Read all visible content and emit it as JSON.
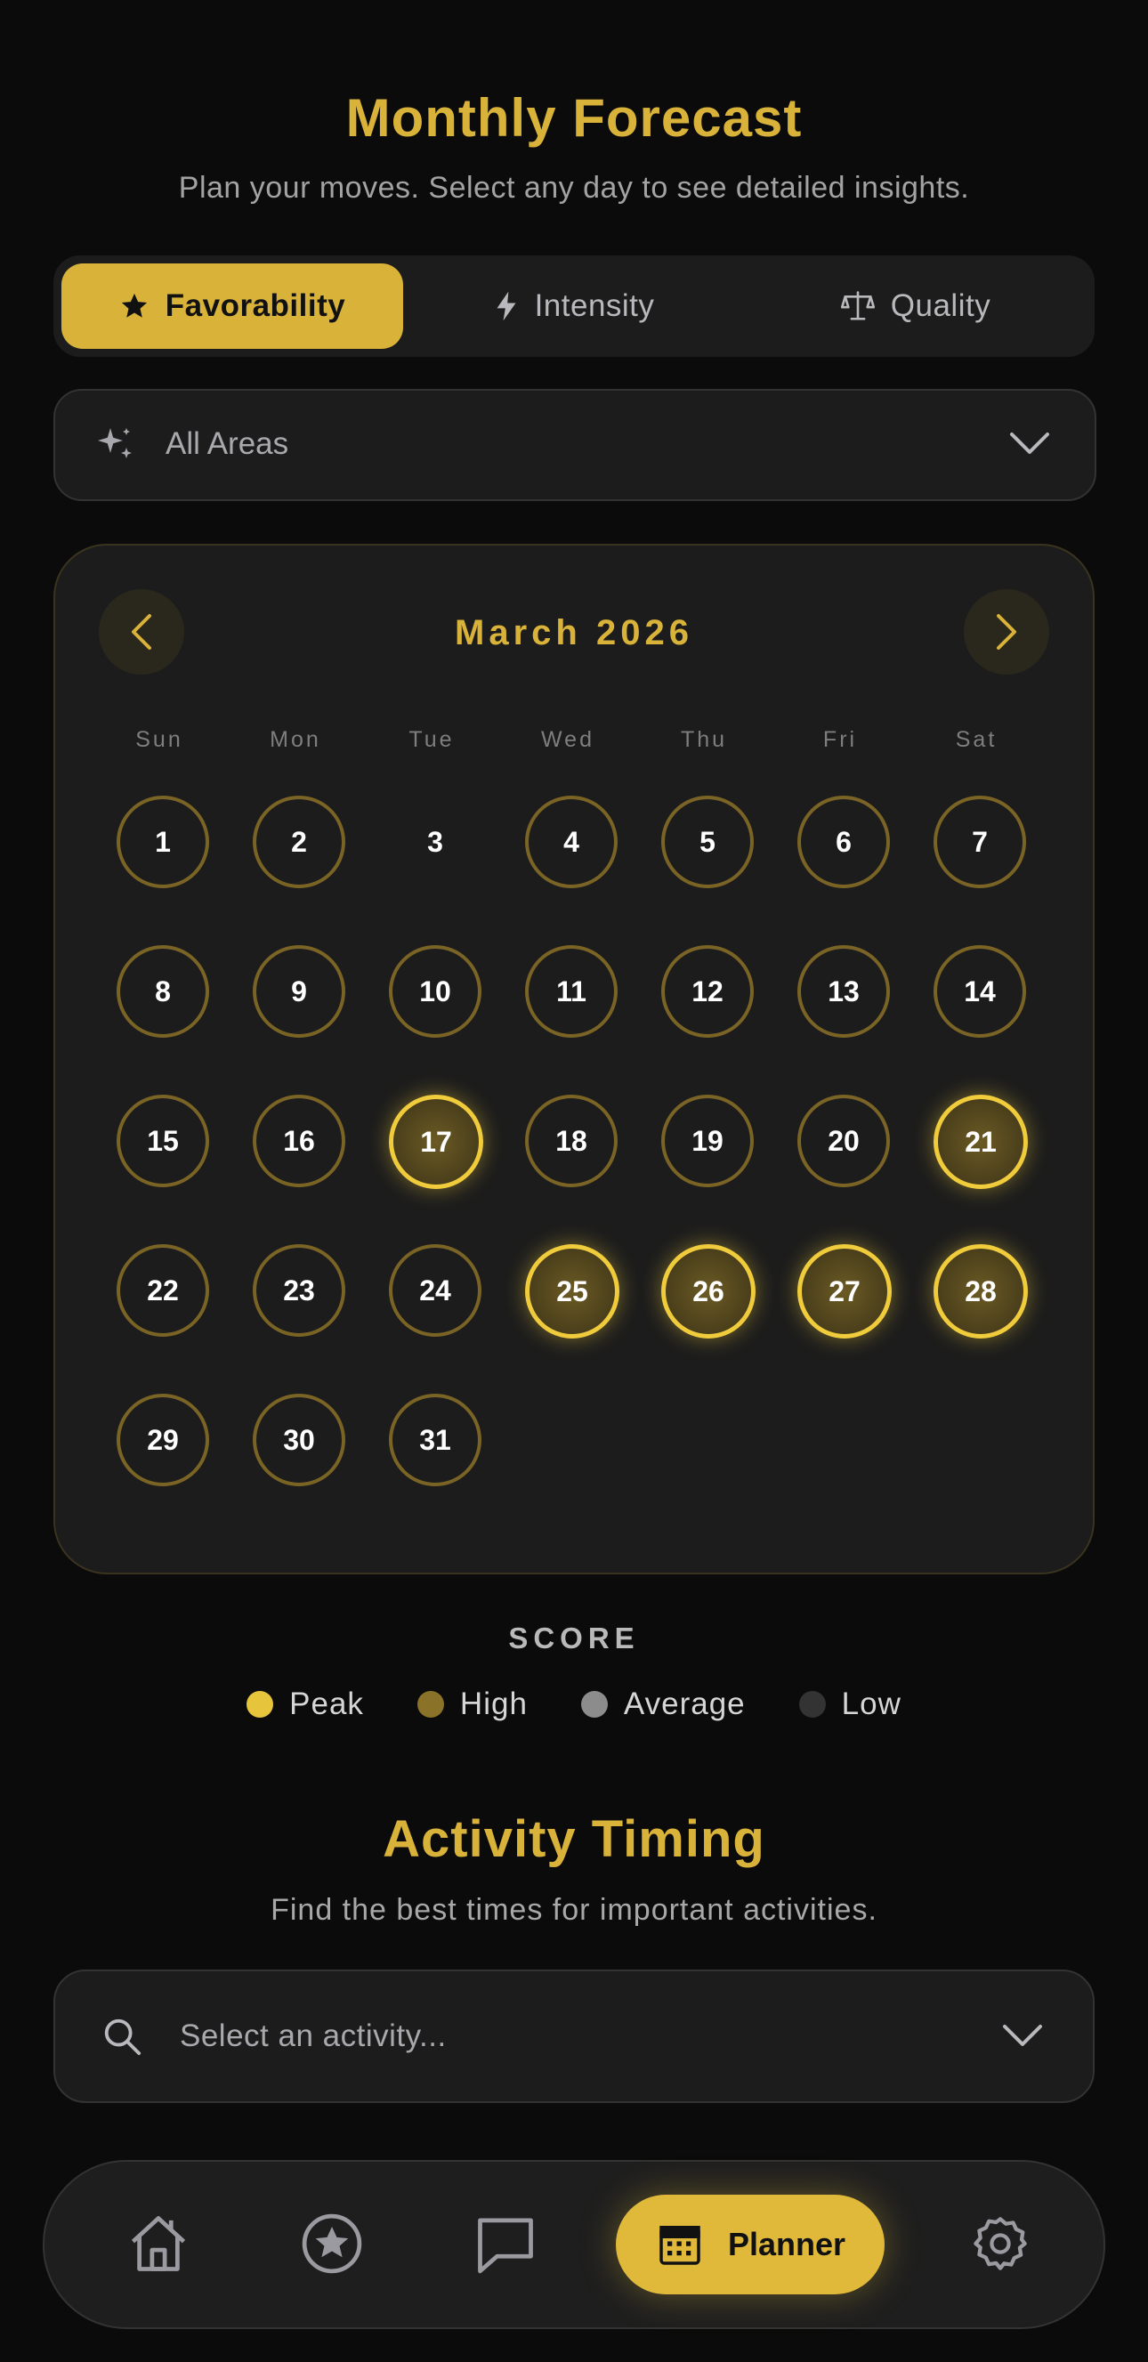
{
  "header": {
    "title": "Monthly Forecast",
    "subtitle": "Plan your moves. Select any day to see detailed insights."
  },
  "tabs": [
    {
      "label": "Favorability",
      "icon": "star-icon",
      "active": true
    },
    {
      "label": "Intensity",
      "icon": "lightning-icon",
      "active": false
    },
    {
      "label": "Quality",
      "icon": "scale-icon",
      "active": false
    }
  ],
  "area_filter": {
    "label": "All Areas",
    "icon": "sparkles-icon"
  },
  "calendar": {
    "month_label": "March 2026",
    "weekdays": [
      "Sun",
      "Mon",
      "Tue",
      "Wed",
      "Thu",
      "Fri",
      "Sat"
    ],
    "first_weekday_index": 0,
    "days": [
      {
        "n": "1",
        "level": "high"
      },
      {
        "n": "2",
        "level": "high"
      },
      {
        "n": "3",
        "level": "low"
      },
      {
        "n": "4",
        "level": "high"
      },
      {
        "n": "5",
        "level": "high"
      },
      {
        "n": "6",
        "level": "high"
      },
      {
        "n": "7",
        "level": "high"
      },
      {
        "n": "8",
        "level": "high"
      },
      {
        "n": "9",
        "level": "high"
      },
      {
        "n": "10",
        "level": "high"
      },
      {
        "n": "11",
        "level": "high"
      },
      {
        "n": "12",
        "level": "high"
      },
      {
        "n": "13",
        "level": "high"
      },
      {
        "n": "14",
        "level": "high"
      },
      {
        "n": "15",
        "level": "high"
      },
      {
        "n": "16",
        "level": "high"
      },
      {
        "n": "17",
        "level": "peak"
      },
      {
        "n": "18",
        "level": "high"
      },
      {
        "n": "19",
        "level": "high"
      },
      {
        "n": "20",
        "level": "high"
      },
      {
        "n": "21",
        "level": "peak"
      },
      {
        "n": "22",
        "level": "high"
      },
      {
        "n": "23",
        "level": "high"
      },
      {
        "n": "24",
        "level": "high"
      },
      {
        "n": "25",
        "level": "peak"
      },
      {
        "n": "26",
        "level": "peak"
      },
      {
        "n": "27",
        "level": "peak"
      },
      {
        "n": "28",
        "level": "peak"
      },
      {
        "n": "29",
        "level": "high"
      },
      {
        "n": "30",
        "level": "high"
      },
      {
        "n": "31",
        "level": "high"
      }
    ]
  },
  "legend": {
    "title": "SCORE",
    "items": [
      {
        "label": "Peak",
        "color": "#e6c53c"
      },
      {
        "label": "High",
        "color": "#8a7228"
      },
      {
        "label": "Average",
        "color": "#8c8c8c"
      },
      {
        "label": "Low",
        "color": "#333333"
      }
    ]
  },
  "activity": {
    "title": "Activity Timing",
    "subtitle": "Find the best times for important activities.",
    "placeholder": "Select an activity..."
  },
  "bottom_nav": {
    "items": [
      "home-icon",
      "star-circle-icon",
      "chat-icon",
      "calendar-icon",
      "gear-icon"
    ],
    "active_label": "Planner"
  },
  "colors": {
    "accent": "#d9b23a",
    "background": "#0b0b0b",
    "card": "#1c1c1c"
  }
}
